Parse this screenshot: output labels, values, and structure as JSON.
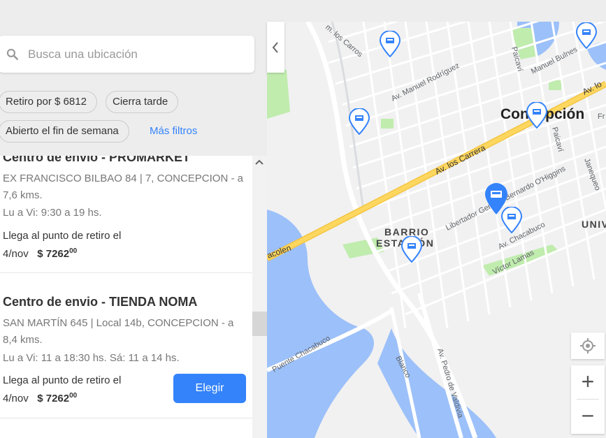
{
  "search": {
    "placeholder": "Busca una ubicación"
  },
  "filters": {
    "chip_pickup_price": "Retiro por $ 6812",
    "chip_closes_late": "Cierra tarde",
    "chip_weekend": "Abierto el fin de semana",
    "more_filters": "Más filtros"
  },
  "results": [
    {
      "name": "Centro de envio - PROMARKET",
      "address": "EX FRANCISCO BILBAO 84 | 7, CONCEPCION - a 7,6 kms.",
      "hours": "Lu a Vi: 9:30 a 19 hs.",
      "arrival_line1": "Llega al punto de retiro el",
      "arrival_date": "4/nov",
      "price": "$ 7262",
      "price_cents": "00"
    },
    {
      "name": "Centro de envio - TIENDA NOMA",
      "address": "SAN MARTÍN 645 | Local 14b, CONCEPCION - a 8,4 kms.",
      "hours": "Lu a Vi: 11 a 18:30 hs. Sá: 11 a 14 hs.",
      "arrival_line1": "Llega al punto de retiro el",
      "arrival_date": "4/nov",
      "price": "$ 7262",
      "price_cents": "00",
      "button": "Elegir"
    }
  ],
  "map": {
    "labels": {
      "city": "Concepción",
      "barrio_1": "BARRIO",
      "barrio_2": "ESTACIÓN",
      "univ": "UNIV",
      "av_los_carrera": "Av. los Carrera",
      "av_los_carrera_2": "Av. lo",
      "av_manuel_rodriguez": "Av. Manuel Rodríguez",
      "manuel_bulnes": "Manuel Bulnes",
      "los_carros": "m. los Carros",
      "paicavi": "Paicaví",
      "paicavi_2": "Paicaví",
      "libertador": "Libertador General Bernardo O'Higgins",
      "chacabuco": "Av. Chacabuco",
      "victor_lamas": "Víctor Lamas",
      "janequeo": "Janequeo",
      "puente_chacabuco": "Puente Chacabuco",
      "pedro_valdivia": "Av. Pedro de Valdivia",
      "blanco": "Blanco",
      "bicentenario": "acolen",
      "fr": "Fr"
    },
    "zoom_in": "+",
    "zoom_out": "−"
  },
  "colors": {
    "accent": "#3483fa",
    "pin": "#3483fa",
    "water": "#9cc0f9",
    "park": "#c0ecae",
    "highway": "#fdd760"
  }
}
